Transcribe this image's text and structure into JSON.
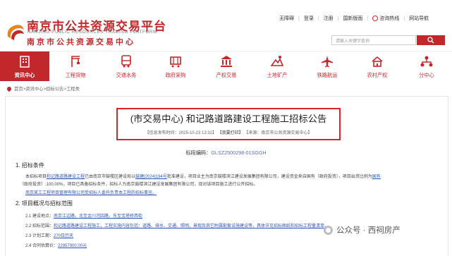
{
  "header": {
    "logo_cn": "南京市公共资源交易平台",
    "logo_en": "NANJING PUBLIC RESOURCES TRADING PLATFORM",
    "logo_sub": "南京市公共资源交易中心",
    "top_links": [
      "无障碍",
      "登录",
      "注册",
      "国新版面",
      "咨询热线",
      "网站导航"
    ],
    "search_placeholder": "请输入关键字查询",
    "accent_color": "#c0282b"
  },
  "nav": {
    "items": [
      {
        "label": "资讯中心",
        "icon": "building-icon",
        "active": true
      },
      {
        "label": "工程货物",
        "icon": "crane-icon",
        "active": false
      },
      {
        "label": "交通水务",
        "icon": "bus-icon",
        "active": false
      },
      {
        "label": "政府采购",
        "icon": "cart-icon",
        "active": false
      },
      {
        "label": "产权交易",
        "icon": "bank-icon",
        "active": false
      },
      {
        "label": "土地矿产",
        "icon": "land-icon",
        "active": false
      },
      {
        "label": "铁路航运",
        "icon": "plane-icon",
        "active": false
      },
      {
        "label": "农村产权",
        "icon": "rural-icon",
        "active": false
      },
      {
        "label": "分中心",
        "icon": "network-icon",
        "active": false
      }
    ]
  },
  "breadcrumb": "首页>资讯中心>招标公告>工程类",
  "article": {
    "title": "(市交易中心) 和记路道路建设工程施工招标公告",
    "meta_date": "【信息发布时间：2025-10-23 13:32】",
    "meta_share": "【我要打印】",
    "meta_source": "【来源：南京市公共资源交易中心】",
    "code_label": "标段编码：",
    "code_value": "GLSZ2500298-01SGGH",
    "section1_title": "1. 招标条件",
    "section1_line1_pre": "本招标项目",
    "section1_line1_link1": "和记路道路建设工程",
    "section1_line1_mid": "已由南京市鼓楼区建设局以",
    "section1_line1_link2": "鼓建[2024]194号",
    "section1_line1_post": "批准建设，项目业主为南京鼓楼滨江建设发展集团有限公司，建设资金来自国有（政府投资），项目出资比例为",
    "section1_line1_end": "国有",
    "section1_line2": "（政府投资）:100.00%，项目已具备招标条件，招标人为南京鼓楼滨江建设发展集团有限公司，现对该项目施工进行公开招标。",
    "section1_line3": "南京某工工程项目管理有限公司受招标人委托负责本工程的招标事宜。",
    "section2_title": "2. 项目概况与招标范围",
    "items": [
      {
        "num": "2.1",
        "label": "建设地点：",
        "value": "南京江边路，北至金川河四路，东至宝塔桥西街"
      },
      {
        "num": "2.2",
        "label": "招标范围：",
        "value": "和记路道路建设工程施工，工程实施内容包括：道路、排水、交通、照明、景观及其它附属配套设施建设等，具体详见招标图纸和招标工程量清单。"
      },
      {
        "num": "2.3",
        "label": "计划工期：",
        "value": "270日历天"
      },
      {
        "num": "2.4",
        "label": "合同估算价：",
        "value": "22957900.00元"
      }
    ]
  },
  "watermark": "公众号 · 西祠房产"
}
